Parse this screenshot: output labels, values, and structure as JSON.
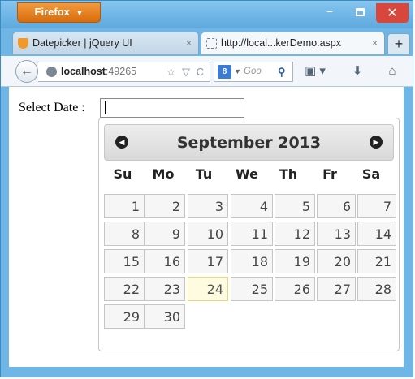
{
  "browser": {
    "app_button": "Firefox",
    "app_button_caret": "▼",
    "window_controls": {
      "minimize": "–",
      "close": "✕"
    },
    "tabs": [
      {
        "label": "Datepicker | jQuery UI",
        "close": "×",
        "icon": "jquery-icon",
        "active": false
      },
      {
        "label": "http://local...kerDemo.aspx",
        "close": "×",
        "icon": "page-icon",
        "active": true
      }
    ],
    "new_tab": "+",
    "url": {
      "host": "localhost",
      "port": ":49265",
      "icons": "☆ ▽ C"
    },
    "search": {
      "badge": "8",
      "caret": "▼",
      "placeholder": "Goo",
      "go": "⚲"
    },
    "toolbar_icons": {
      "bookmarks": "▣ ▾",
      "download": "⬇",
      "home": "⌂"
    }
  },
  "page": {
    "label": "Select Date :",
    "input_value": ""
  },
  "datepicker": {
    "prev": "◀",
    "next": "▶",
    "title": "September 2013",
    "weekdays": [
      "Su",
      "Mo",
      "Tu",
      "We",
      "Th",
      "Fr",
      "Sa"
    ],
    "weeks": [
      [
        "1",
        "2",
        "3",
        "4",
        "5",
        "6",
        "7"
      ],
      [
        "8",
        "9",
        "10",
        "11",
        "12",
        "13",
        "14"
      ],
      [
        "15",
        "16",
        "17",
        "18",
        "19",
        "20",
        "21"
      ],
      [
        "22",
        "23",
        "24",
        "25",
        "26",
        "27",
        "28"
      ],
      [
        "29",
        "30"
      ]
    ],
    "today": "24"
  }
}
